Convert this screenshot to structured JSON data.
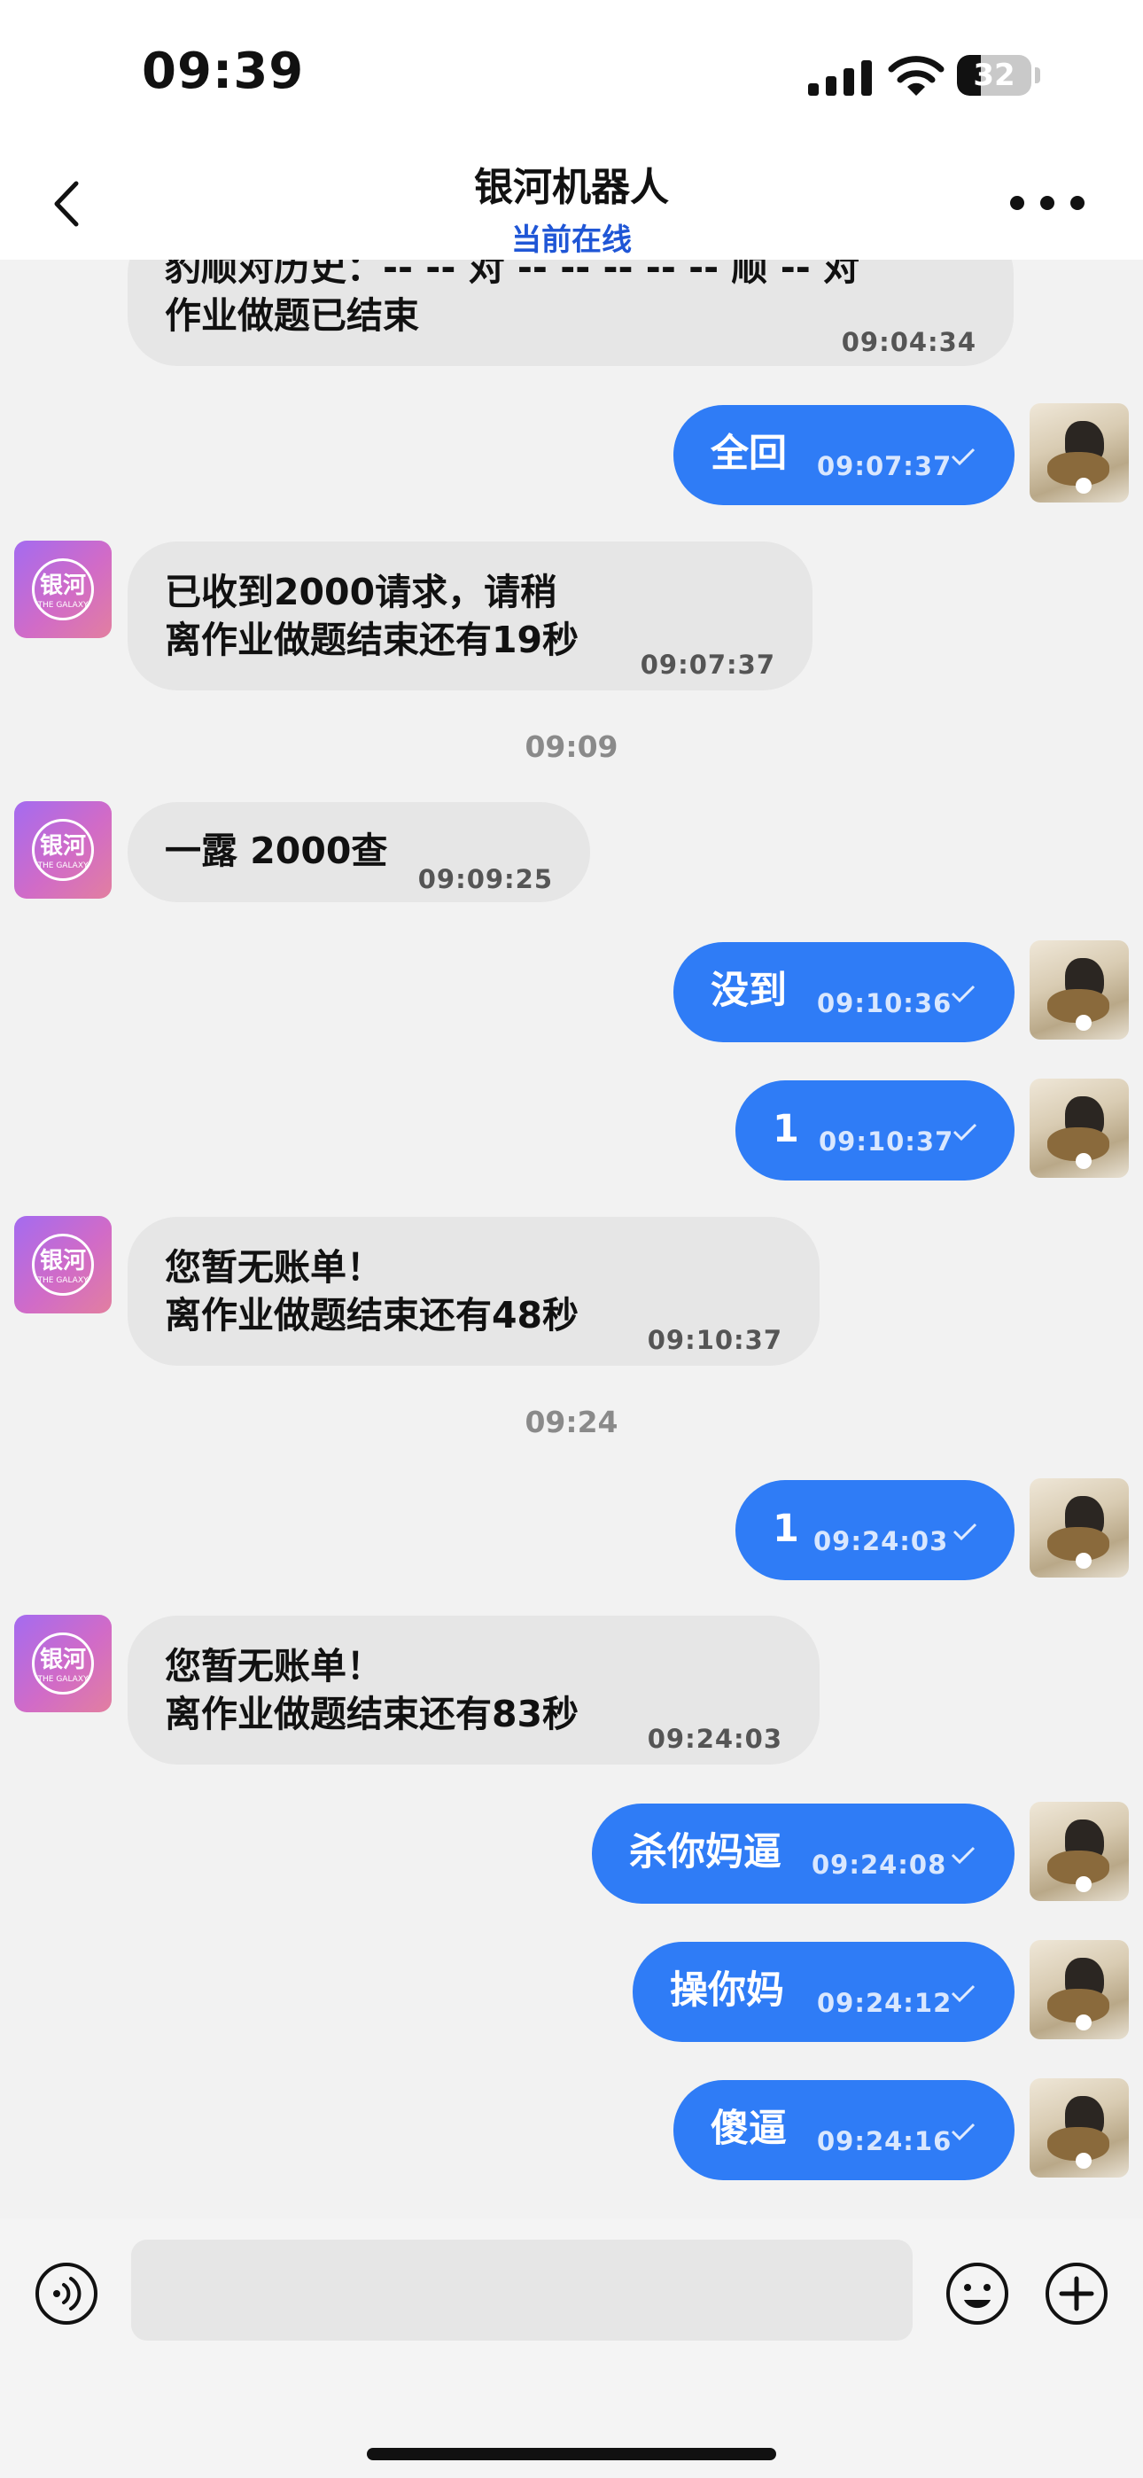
{
  "status_bar": {
    "time": "09:39",
    "battery": "32"
  },
  "header": {
    "title": "银河机器人",
    "subtitle": "当前在线"
  },
  "bot_avatar": {
    "glyph": "银河",
    "tag": "THE GALAXY"
  },
  "messages": [
    {
      "side": "in",
      "text": "豹顺对历史：-- -- 对 -- -- -- -- -- 顺 -- 对\n作业做题已结束",
      "time": "09:04:34"
    },
    {
      "side": "out",
      "text": "全回",
      "time": "09:07:37"
    },
    {
      "side": "in",
      "text": "已收到2000请求，请稍\n离作业做题结束还有19秒",
      "time": "09:07:37"
    },
    {
      "side": "divider",
      "text": "09:09"
    },
    {
      "side": "in",
      "text": "一露 2000查",
      "time": "09:09:25"
    },
    {
      "side": "out",
      "text": "没到",
      "time": "09:10:36"
    },
    {
      "side": "out",
      "text": "1",
      "time": "09:10:37"
    },
    {
      "side": "in",
      "text": "您暂无账单！\n离作业做题结束还有48秒",
      "time": "09:10:37"
    },
    {
      "side": "divider",
      "text": "09:24"
    },
    {
      "side": "out",
      "text": "1",
      "time": "09:24:03"
    },
    {
      "side": "in",
      "text": "您暂无账单！\n离作业做题结束还有83秒",
      "time": "09:24:03"
    },
    {
      "side": "out",
      "text": "杀你妈逼",
      "time": "09:24:08"
    },
    {
      "side": "out",
      "text": "操你妈",
      "time": "09:24:12"
    },
    {
      "side": "out",
      "text": "傻逼",
      "time": "09:24:16"
    }
  ],
  "icons": {
    "back": "chevron-left-icon",
    "more": "more-horizontal-icon",
    "voice": "voice-icon",
    "emoji": "emoji-icon",
    "add": "plus-circle-icon",
    "read": "check-icon"
  },
  "colors": {
    "outgoing_bubble": "#2f7cf6",
    "incoming_bubble": "#e6e6e6",
    "accent_text": "#1f56d6"
  }
}
